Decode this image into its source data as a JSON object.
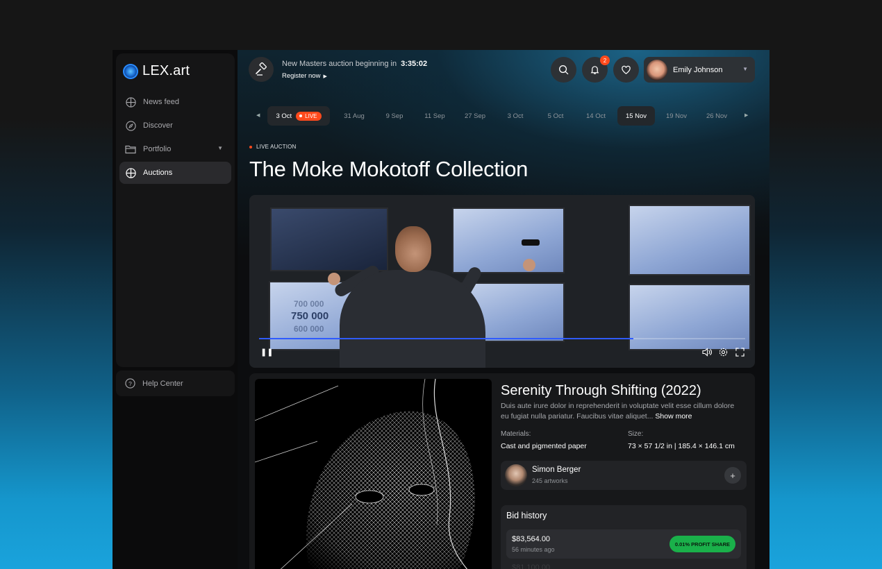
{
  "brand": {
    "name": "LEX.art"
  },
  "sidebar": {
    "items": [
      {
        "label": "News feed",
        "icon": "grid-icon"
      },
      {
        "label": "Discover",
        "icon": "compass-icon"
      },
      {
        "label": "Portfolio",
        "icon": "folder-icon"
      },
      {
        "label": "Auctions",
        "icon": "grid-icon",
        "active": true
      }
    ],
    "help_label": "Help Center"
  },
  "topbar": {
    "countdown_text": "New Masters auction beginning in",
    "countdown_time": "3:35:02",
    "register_label": "Register now",
    "notifications_count": "2",
    "user_name": "Emily Johnson"
  },
  "dates": {
    "items": [
      "3 Oct",
      "31 Aug",
      "9 Sep",
      "11 Sep",
      "27 Sep",
      "3 Oct",
      "5 Oct",
      "14 Oct",
      "15 Nov",
      "19 Nov",
      "26 Nov"
    ],
    "live_label": "LIVE",
    "selected": "15 Nov"
  },
  "auction": {
    "label": "LIVE AUCTION",
    "title": "The Moke Mokotoff Collection"
  },
  "video": {
    "screen_price_1": "700 000",
    "screen_price_2": "750 000",
    "screen_price_3": "600 000",
    "progress": 0.77
  },
  "artwork": {
    "title": "Serenity Through Shifting (2022)",
    "description": "Duis aute irure dolor in reprehenderit in voluptate velit esse cillum dolore eu fugiat nulla pariatur. Faucibus vitae aliquet...",
    "show_more": "Show more",
    "materials_label": "Materials:",
    "materials_value": "Cast and pigmented paper",
    "size_label": "Size:",
    "size_value": "73 × 57 1/2 in | 185.4 × 146.1 cm"
  },
  "artist": {
    "name": "Simon Berger",
    "artworks": "245 artworks"
  },
  "bid_history": {
    "title": "Bid history",
    "rows": [
      {
        "amount": "$83,564.00",
        "time": "56 minutes ago",
        "badge": "0.01% PROFIT SHARE"
      },
      {
        "amount": "$81,100.00"
      }
    ]
  },
  "colors": {
    "accent_live": "#ff4a1c",
    "profit_green": "#1ab04a",
    "progress_blue": "#2f5bff"
  }
}
